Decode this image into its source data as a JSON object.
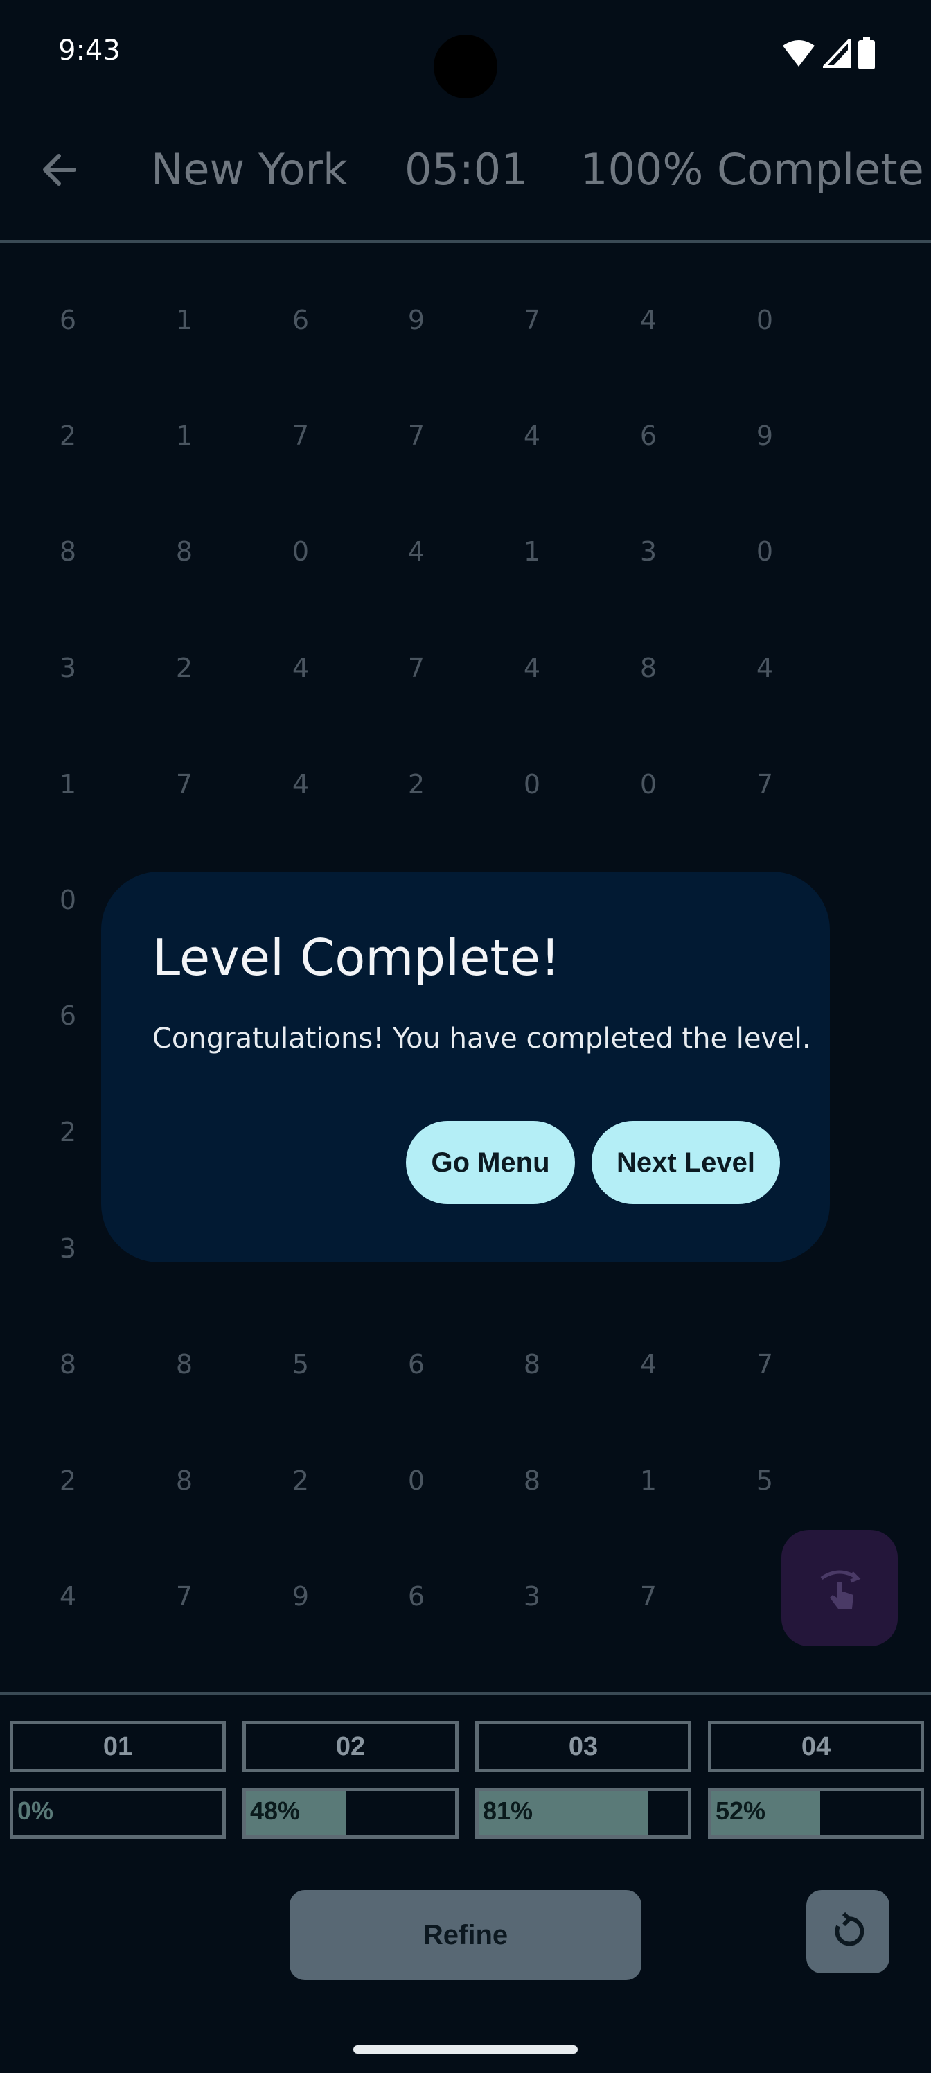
{
  "status_bar": {
    "time": "9:43"
  },
  "app_bar": {
    "city": "New York",
    "timer": "05:01",
    "progress": "100% Complete"
  },
  "grid": {
    "rows": [
      [
        "6",
        "1",
        "6",
        "9",
        "7",
        "4",
        "0"
      ],
      [
        "2",
        "1",
        "7",
        "7",
        "4",
        "6",
        "9"
      ],
      [
        "8",
        "8",
        "0",
        "4",
        "1",
        "3",
        "0"
      ],
      [
        "3",
        "2",
        "4",
        "7",
        "4",
        "8",
        "4"
      ],
      [
        "1",
        "7",
        "4",
        "2",
        "0",
        "0",
        "7"
      ],
      [
        "0",
        "",
        "",
        "",
        "",
        "",
        ""
      ],
      [
        "6",
        "",
        "",
        "",
        "",
        "",
        ""
      ],
      [
        "2",
        "",
        "",
        "",
        "",
        "",
        ""
      ],
      [
        "3",
        "",
        "",
        "",
        "",
        "",
        ""
      ],
      [
        "8",
        "8",
        "5",
        "6",
        "8",
        "4",
        "7"
      ],
      [
        "2",
        "8",
        "2",
        "0",
        "8",
        "1",
        "5"
      ],
      [
        "4",
        "7",
        "9",
        "6",
        "3",
        "7",
        ""
      ]
    ]
  },
  "dialog": {
    "title": "Level Complete!",
    "body": "Congratulations! You have completed the level.",
    "go_menu_label": "Go Menu",
    "next_level_label": "Next Level"
  },
  "levels": [
    {
      "label": "01",
      "progress_text": "0%",
      "progress": 0.0
    },
    {
      "label": "02",
      "progress_text": "48%",
      "progress": 0.48
    },
    {
      "label": "03",
      "progress_text": "81%",
      "progress": 0.81
    },
    {
      "label": "04",
      "progress_text": "52%",
      "progress": 0.52
    }
  ],
  "refine_label": "Refine",
  "icons": {
    "back": "arrow-left-icon",
    "fab": "touch-rotate-icon",
    "reset": "refresh-icon"
  },
  "colors": {
    "background": "#040d17",
    "dialog": "#021a33",
    "dialog_button": "#b4eef6",
    "fab": "#24163a",
    "progress_fill": "#5a7a78"
  }
}
